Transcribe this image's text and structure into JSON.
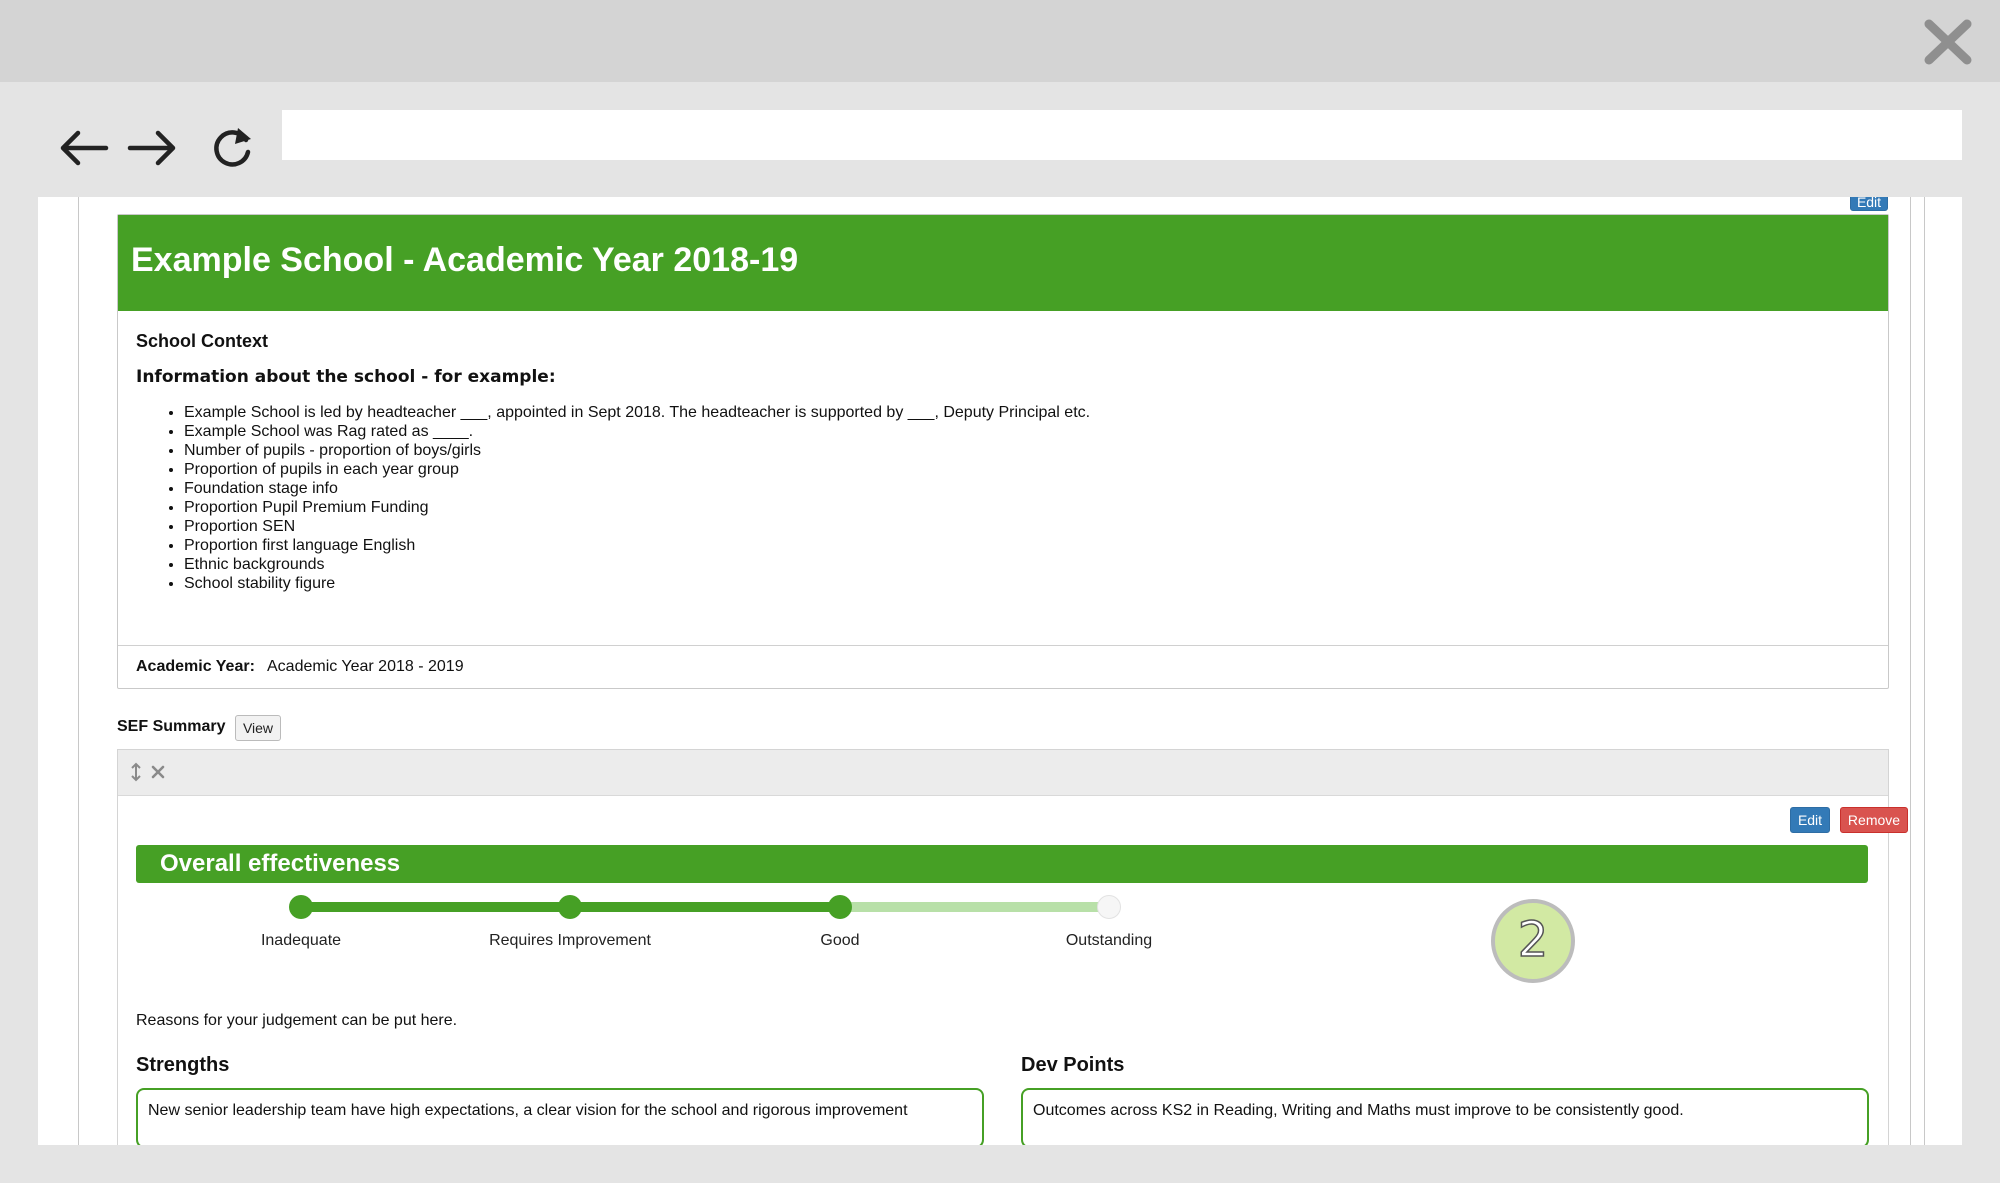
{
  "browser": {
    "url_value": ""
  },
  "page": {
    "edit_top_label": "Edit",
    "school_title": "Example School - Academic Year 2018-19",
    "context_title": "School Context",
    "info_title": "Information about the school - for example:",
    "context_items": [
      "Example School is led by headteacher ___, appointed in Sept 2018. The headteacher is supported by ___, Deputy Principal etc.",
      "Example School was Rag rated as ____.",
      "Number of pupils - proportion of boys/girls",
      "Proportion of pupils in each year group",
      "Foundation stage info",
      "Proportion Pupil Premium Funding",
      "Proportion SEN",
      "Proportion first language English",
      "Ethnic backgrounds",
      "School stability figure"
    ],
    "academic_year_label": "Academic Year:",
    "academic_year_value": "Academic Year 2018 - 2019",
    "sef_label": "SEF Summary",
    "view_label": "View"
  },
  "sef": {
    "edit_label": "Edit",
    "remove_label": "Remove",
    "overall_title": "Overall effectiveness",
    "scale": {
      "labels": [
        "Inadequate",
        "Requires Improvement",
        "Good",
        "Outstanding"
      ],
      "selected_index": 2
    },
    "grade": "2",
    "reasons": "Reasons for your judgement can be put here.",
    "strengths_heading": "Strengths",
    "strengths_text": "New senior leadership team have high expectations, a clear vision for the school and rigorous improvement",
    "devpoints_heading": "Dev Points",
    "devpoints_text": "Outcomes across KS2 in Reading, Writing and Maths must improve to be consistently good."
  },
  "colors": {
    "brand_green": "#46a025",
    "light_green_track": "#b8e0a8",
    "grade_fill": "#d2e9a3",
    "edit_blue": "#337ab7",
    "remove_red": "#d9534f"
  },
  "icons": {
    "close": "close-icon",
    "back": "arrow-left-icon",
    "forward": "arrow-right-icon",
    "reload": "reload-icon",
    "move": "move-vertical-icon",
    "remove": "small-x-icon"
  }
}
